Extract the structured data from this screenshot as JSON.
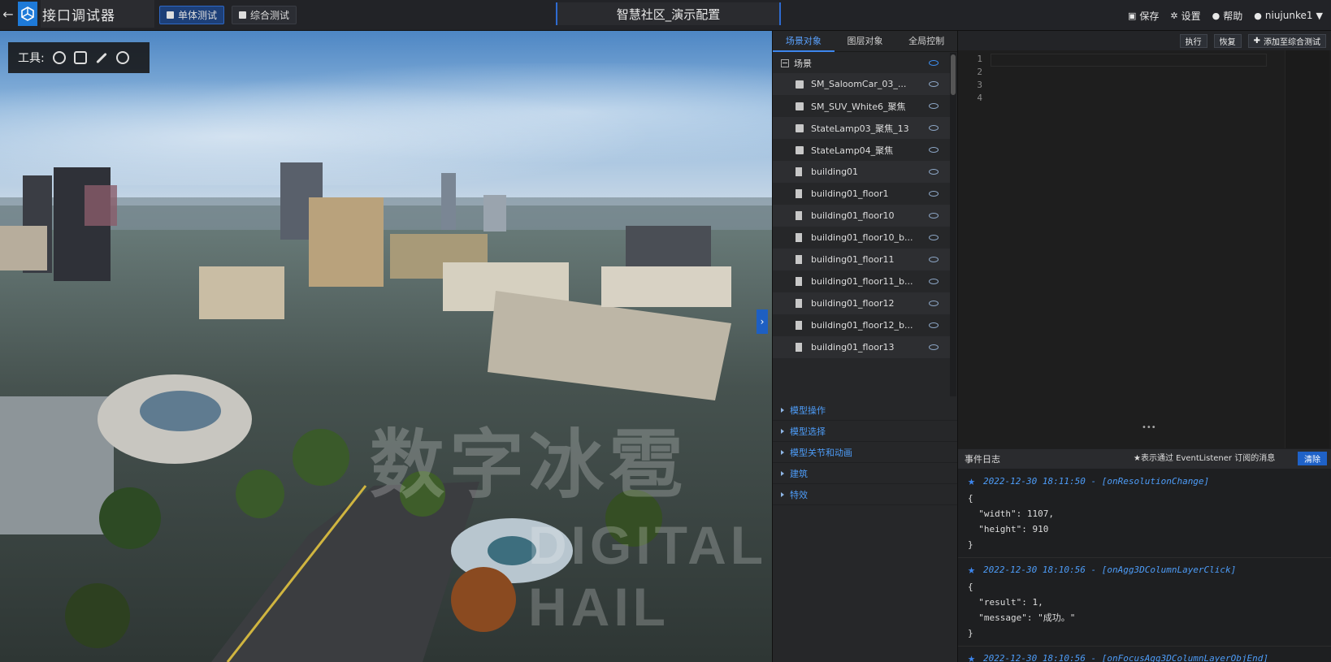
{
  "app": {
    "title": "接口调试器",
    "back_symbol": "←"
  },
  "modes": [
    {
      "label": "单体测试",
      "active": true
    },
    {
      "label": "综合测试",
      "active": false
    }
  ],
  "project_title": "智慧社区_演示配置",
  "top_actions": {
    "save": "保存",
    "settings": "设置",
    "help": "帮助",
    "user": "niujunke1"
  },
  "viewport": {
    "toolbox_label": "工具:",
    "watermark_cn": "数字冰雹",
    "watermark_en": "DIGITAL HAIL",
    "toggle_symbol": "›"
  },
  "middle": {
    "tabs": [
      {
        "label": "场景对象",
        "active": true
      },
      {
        "label": "图层对象",
        "active": false
      },
      {
        "label": "全局控制",
        "active": false
      }
    ],
    "root": "场景",
    "items": [
      {
        "label": "SM_SaloomCar_03_...",
        "icon": "cube-icon"
      },
      {
        "label": "SM_SUV_White6_聚焦",
        "icon": "cube-icon"
      },
      {
        "label": "StateLamp03_聚焦_13",
        "icon": "cube-icon"
      },
      {
        "label": "StateLamp04_聚焦",
        "icon": "cube-icon"
      },
      {
        "label": "building01",
        "icon": "building-icon"
      },
      {
        "label": "building01_floor1",
        "icon": "building-icon"
      },
      {
        "label": "building01_floor10",
        "icon": "building-icon"
      },
      {
        "label": "building01_floor10_b...",
        "icon": "building-icon"
      },
      {
        "label": "building01_floor11",
        "icon": "building-icon"
      },
      {
        "label": "building01_floor11_b...",
        "icon": "building-icon"
      },
      {
        "label": "building01_floor12",
        "icon": "building-icon"
      },
      {
        "label": "building01_floor12_b...",
        "icon": "building-icon"
      },
      {
        "label": "building01_floor13",
        "icon": "building-icon"
      }
    ],
    "sections": [
      "模型操作",
      "模型选择",
      "模型关节和动画",
      "建筑",
      "特效"
    ]
  },
  "editor": {
    "buttons": {
      "execute": "执行",
      "restore": "恢复",
      "add": "添加至综合测试"
    },
    "line_numbers": [
      "1",
      "2",
      "3",
      "4"
    ]
  },
  "log": {
    "title": "事件日志",
    "subtitle": "★表示通过 EventListener 订阅的消息",
    "clear": "清除",
    "entries": [
      {
        "time": "2022-12-30 18:11:50 - [onResolutionChange]",
        "body": "{\n  \"width\": 1107,\n  \"height\": 910\n}"
      },
      {
        "time": "2022-12-30 18:10:56 - [onAgg3DColumnLayerClick]",
        "body": "{\n  \"result\": 1,\n  \"message\": \"成功。\"\n}"
      },
      {
        "time": "2022-12-30 18:10:56 - [onFocusAgg3DColumnLayerObjEnd]",
        "body": ""
      }
    ]
  },
  "colors": {
    "accent": "#1e7ad8",
    "link": "#4d9cf8",
    "active_tab_bg": "#1d3f78"
  }
}
